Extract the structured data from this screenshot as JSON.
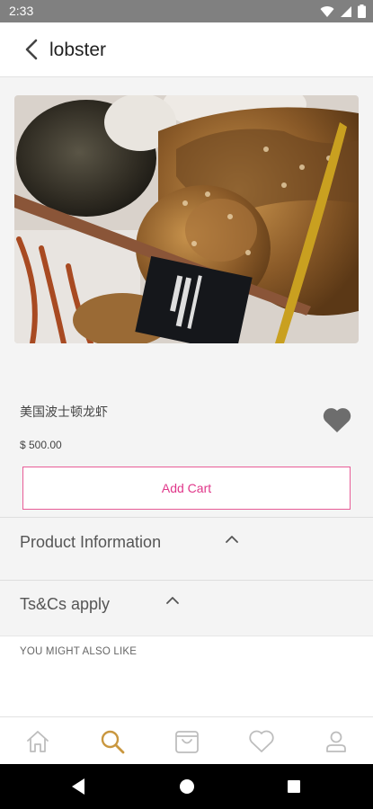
{
  "status_bar": {
    "time": "2:33"
  },
  "header": {
    "title": "lobster"
  },
  "product": {
    "name": "美国波士顿龙虾",
    "price": "$ 500.00",
    "add_cart_label": "Add Cart"
  },
  "sections": [
    {
      "label": "Product Information"
    },
    {
      "label": "Ts&Cs apply"
    }
  ],
  "also_like_label": "YOU MIGHT ALSO LIKE",
  "bottom_nav": {
    "active_color": "#c9973f",
    "inactive_color": "#bdbdbd",
    "items": [
      "home-icon",
      "search-icon",
      "cart-icon",
      "heart-icon",
      "profile-icon"
    ]
  },
  "colors": {
    "accent": "#e0378a"
  }
}
